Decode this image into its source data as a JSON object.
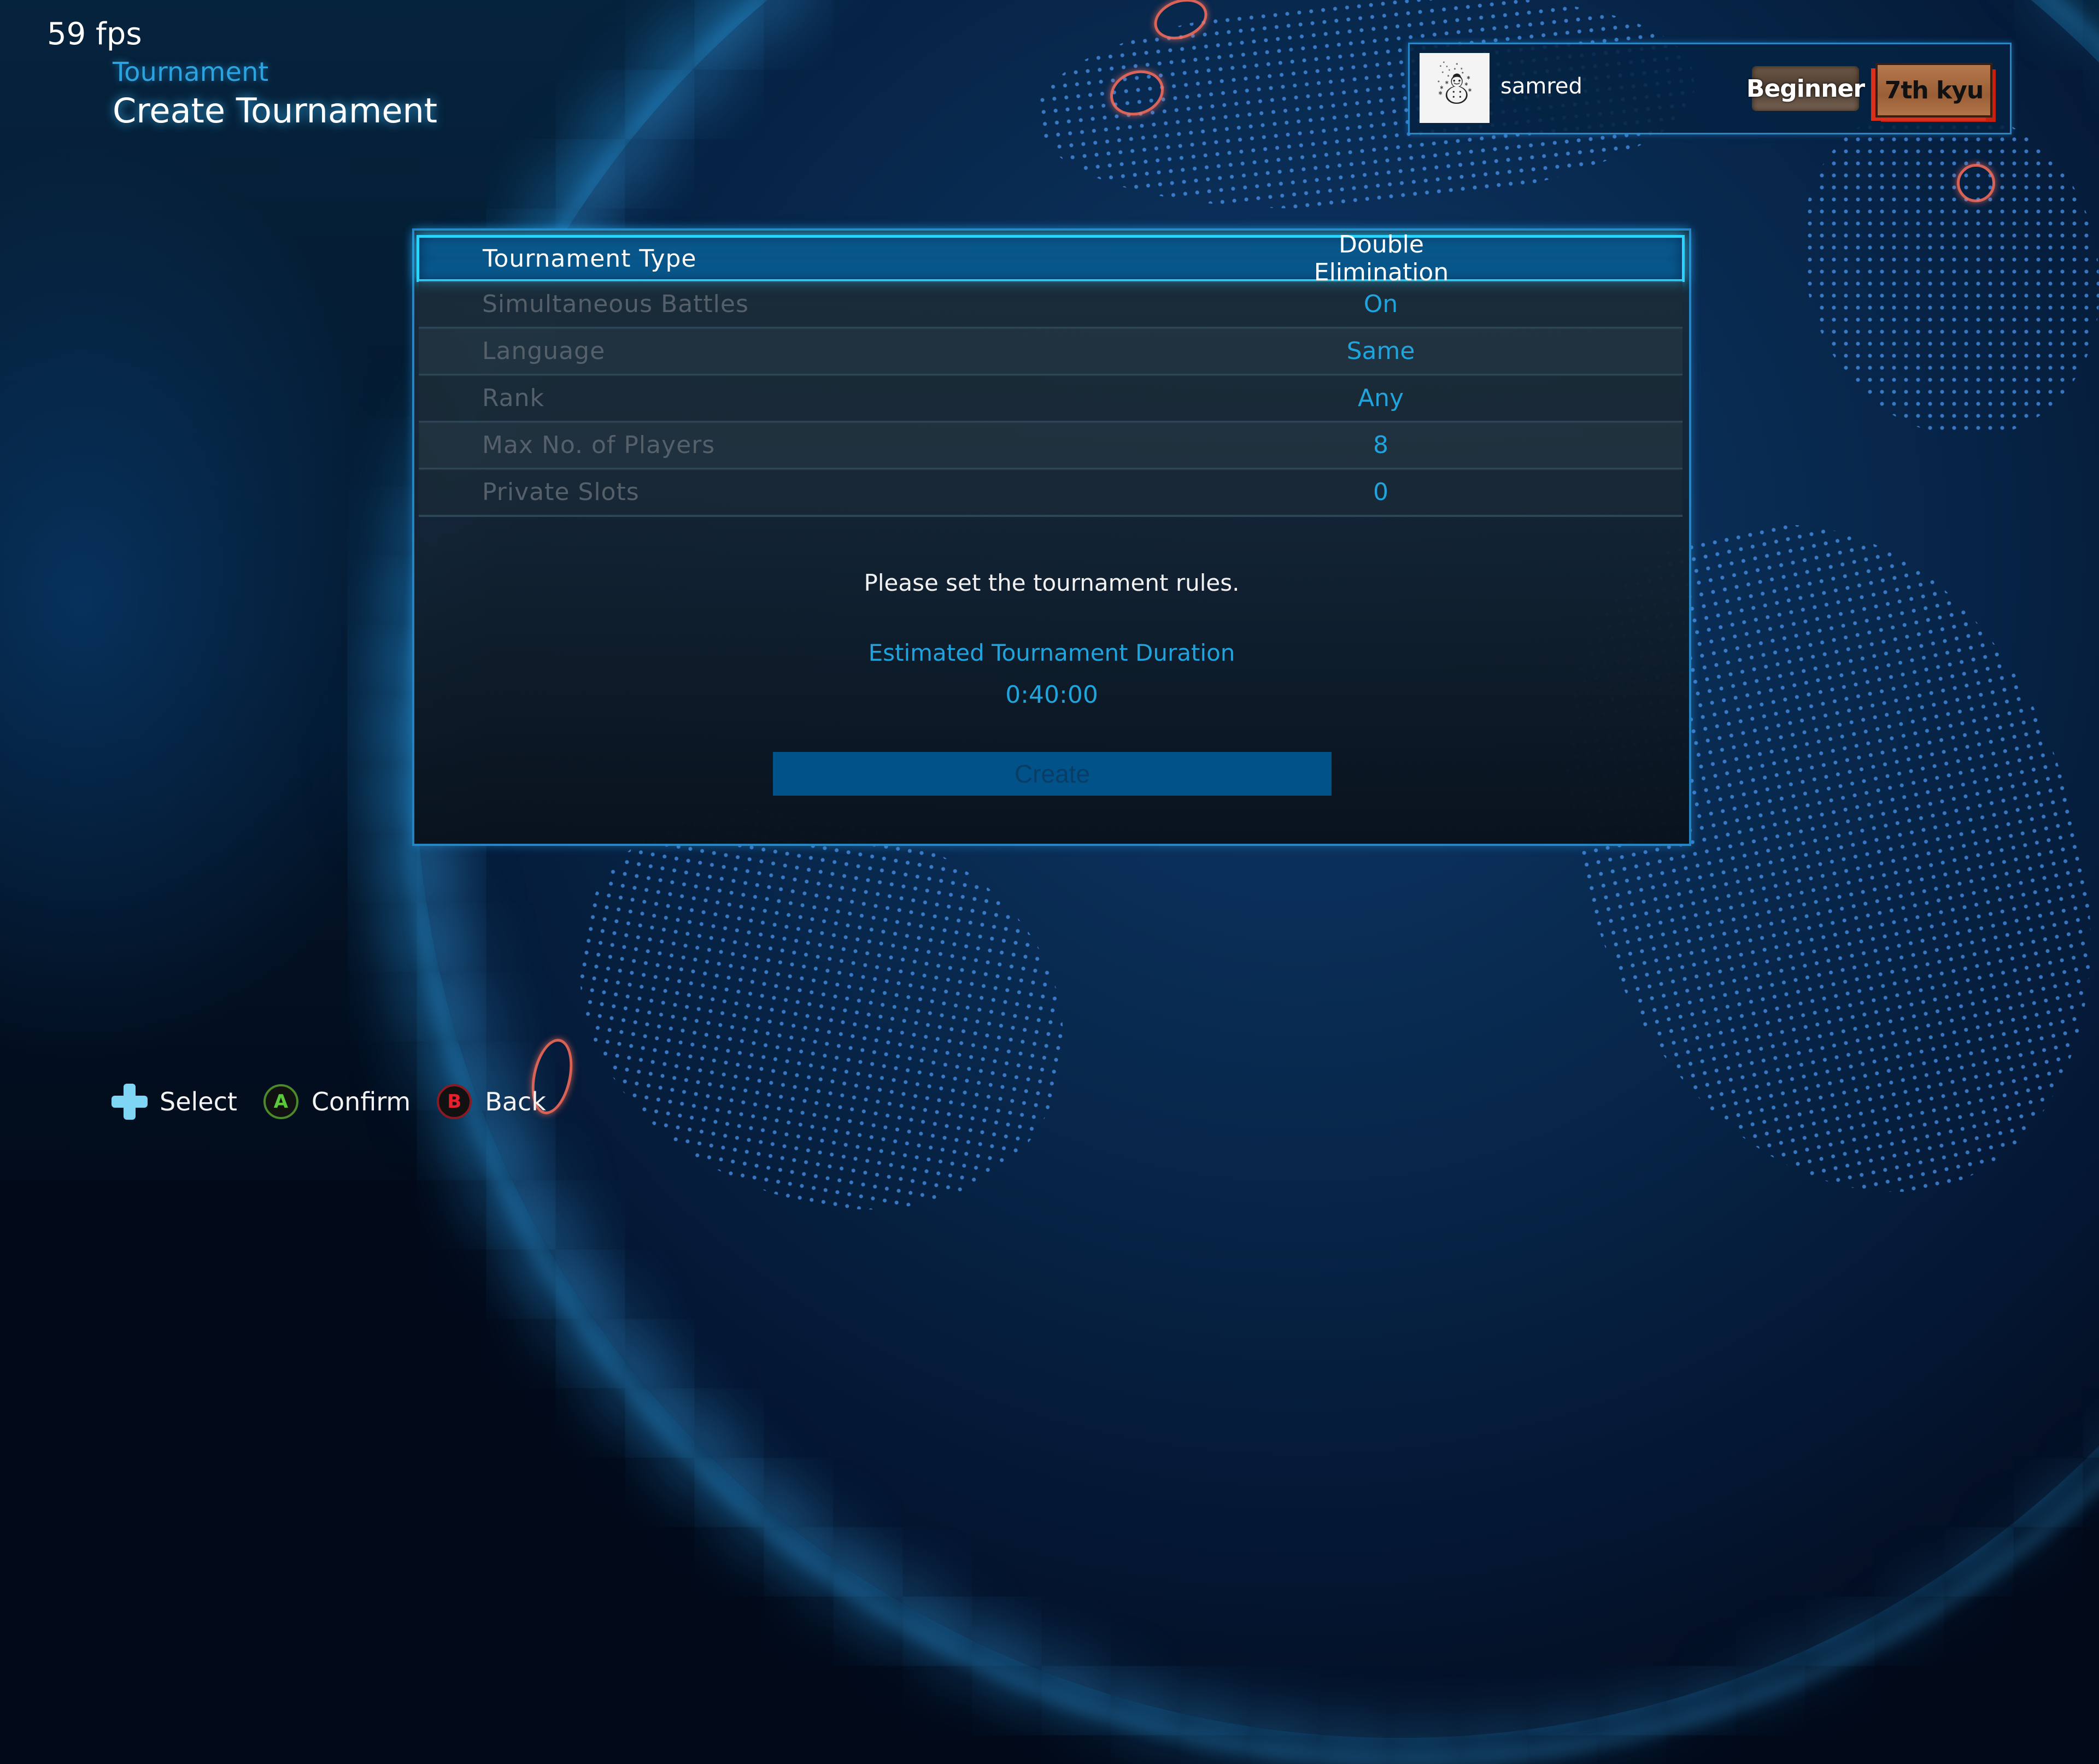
{
  "hud": {
    "fps": "59 fps"
  },
  "header": {
    "breadcrumb": "Tournament",
    "title": "Create Tournament"
  },
  "profile": {
    "avatar_icon": "☃",
    "name": "samred",
    "rank_title": "Beginner",
    "rank_grade": "7th kyu"
  },
  "settings": {
    "rows": [
      {
        "label": "Tournament Type",
        "value": "Double Elimination",
        "selected": true
      },
      {
        "label": "Simultaneous Battles",
        "value": "On"
      },
      {
        "label": "Language",
        "value": "Same"
      },
      {
        "label": "Rank",
        "value": "Any"
      },
      {
        "label": "Max No. of Players",
        "value": "8"
      },
      {
        "label": "Private Slots",
        "value": "0"
      }
    ],
    "message": "Please set the tournament rules.",
    "estimated_label": "Estimated Tournament Duration",
    "estimated_value": "0:40:00",
    "create_label": "Create"
  },
  "footer": {
    "prompts": [
      {
        "icon": "dpad-icon",
        "label": "Select"
      },
      {
        "icon": "a-button-icon",
        "glyph": "A",
        "label": "Confirm"
      },
      {
        "icon": "b-button-icon",
        "glyph": "B",
        "label": "Back"
      }
    ]
  },
  "colors": {
    "accent": "#1fa4de",
    "selected_border": "#2ad4ff",
    "create_button": "#02528a",
    "confirm_green": "#5ac83a",
    "back_red": "#e8202e"
  }
}
